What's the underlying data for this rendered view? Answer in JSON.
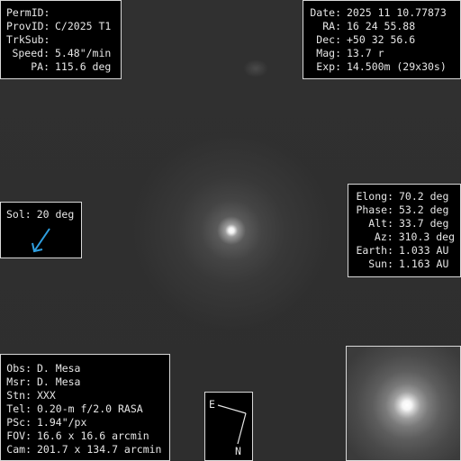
{
  "target": {
    "permid_label": "PermID:",
    "permid_value": "",
    "provid_label": "ProvID:",
    "provid_value": "C/2025 T1",
    "trksub_label": "TrkSub:",
    "trksub_value": "",
    "speed_label": "Speed:",
    "speed_value": "5.48\"/min",
    "pa_label": "PA:",
    "pa_value": "115.6 deg"
  },
  "observation": {
    "date_label": "Date:",
    "date_value": "2025 11 10.77873",
    "ra_label": "RA:",
    "ra_value": "16 24 55.88",
    "dec_label": "Dec:",
    "dec_value": "+50 32 56.6",
    "mag_label": "Mag:",
    "mag_value": "13.7 r",
    "exp_label": "Exp:",
    "exp_value": "14.500m (29x30s)"
  },
  "sun": {
    "label": "Sol:",
    "value": "20 deg",
    "arrow_color": "#2f9fe0"
  },
  "geometry": {
    "elong_label": "Elong:",
    "elong_value": "70.2 deg",
    "phase_label": "Phase:",
    "phase_value": "53.2 deg",
    "alt_label": "Alt:",
    "alt_value": "33.7 deg",
    "az_label": "Az:",
    "az_value": "310.3 deg",
    "earth_label": "Earth:",
    "earth_value": "1.033 AU",
    "sun_label": "Sun:",
    "sun_value": "1.163 AU"
  },
  "observer": {
    "obs_label": "Obs:",
    "obs_value": "D. Mesa",
    "msr_label": "Msr:",
    "msr_value": "D. Mesa",
    "stn_label": "Stn:",
    "stn_value": "XXX",
    "tel_label": "Tel:",
    "tel_value": "0.20-m f/2.0 RASA",
    "psc_label": "PSc:",
    "psc_value": "1.94\"/px",
    "fov_label": "FOV:",
    "fov_value": "16.6 x 16.6 arcmin",
    "cam_label": "Cam:",
    "cam_value": "201.7 x 134.7 arcmin"
  },
  "compass": {
    "east_label": "E",
    "north_label": "N"
  },
  "colors": {
    "sky_background": "#303030",
    "panel_background": "#000000",
    "panel_text": "#e6e6e6",
    "panel_border": "#d8d8d8"
  }
}
